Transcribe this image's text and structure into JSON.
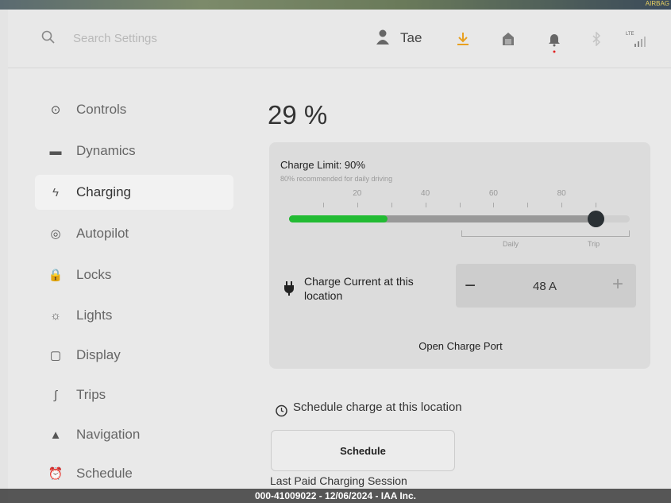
{
  "header": {
    "search_placeholder": "Search Settings",
    "user_name": "Tae",
    "top_badge": "AIRBAG",
    "signal_label": "LTE"
  },
  "sidebar": {
    "items": [
      {
        "label": "Controls",
        "icon": "toggle-icon",
        "glyph": "⊙"
      },
      {
        "label": "Dynamics",
        "icon": "car-icon",
        "glyph": "▬"
      },
      {
        "label": "Charging",
        "icon": "bolt-icon",
        "glyph": "ϟ",
        "active": true
      },
      {
        "label": "Autopilot",
        "icon": "steering-wheel-icon",
        "glyph": "◎"
      },
      {
        "label": "Locks",
        "icon": "lock-icon",
        "glyph": "🔒"
      },
      {
        "label": "Lights",
        "icon": "sun-icon",
        "glyph": "☼"
      },
      {
        "label": "Display",
        "icon": "display-icon",
        "glyph": "▢"
      },
      {
        "label": "Trips",
        "icon": "trips-icon",
        "glyph": "∫"
      },
      {
        "label": "Navigation",
        "icon": "navigation-icon",
        "glyph": "▲"
      },
      {
        "label": "Schedule",
        "icon": "alarm-icon",
        "glyph": "⏰"
      }
    ]
  },
  "charging": {
    "battery_percent": "29 %",
    "battery_level": 29,
    "charge_limit_title": "Charge Limit: 90%",
    "charge_limit": 90,
    "recommend": "80% recommended for daily driving",
    "ticks": [
      "20",
      "40",
      "60",
      "80"
    ],
    "daily_label": "Daily",
    "trip_label": "Trip",
    "current_label": "Charge Current at this location",
    "current_value": "48 A",
    "minus": "−",
    "plus": "+",
    "open_port": "Open Charge Port",
    "schedule_title": "Schedule charge at this location",
    "schedule_button": "Schedule",
    "last_paid": "Last Paid Charging Session",
    "colors": {
      "charge": "#22bb33",
      "download": "#e8a020",
      "alert": "#e02020"
    }
  },
  "footer": {
    "watermark": "000-41009022 - 12/06/2024 - IAA Inc."
  }
}
